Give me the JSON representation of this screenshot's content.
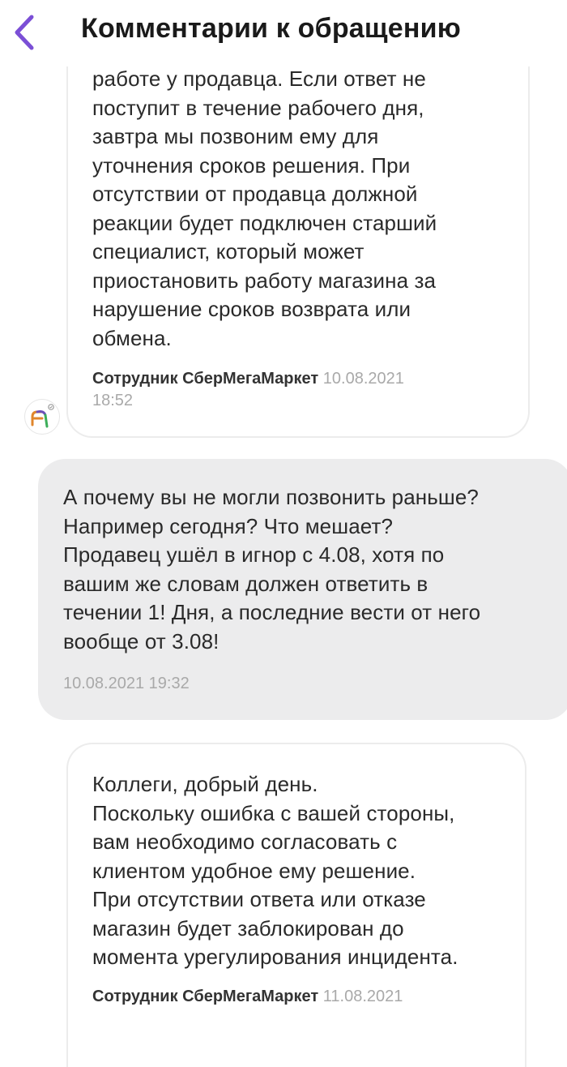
{
  "header": {
    "title": "Комментарии к обращению",
    "back_icon": "chevron-left-icon",
    "accent": "#7b4fd6"
  },
  "messages": [
    {
      "text": "работе у продавца. Если ответ не\nпоступит в течение рабочего дня,\nзавтра мы позвоним ему для\nуточнения сроков решения. При\nотсутствии от продавца должной\nреакции будет подключен старший\nспециалист, который может\nприостановить работу магазина за\nнарушение сроков возврата или\nобмена.",
      "author": "Сотрудник СберМегаМаркет",
      "date": "10.08.2021",
      "time": "18:52"
    },
    {
      "text": "А почему вы не могли позвонить раньше?\nНапример сегодня? Что мешает?\nПродавец ушёл в игнор с 4.08, хотя по\nвашим же словам должен ответить в\nтечении 1! Дня, а последние вести от него\nвообще от 3.08!",
      "timestamp": "10.08.2021 19:32"
    },
    {
      "text": "Коллеги, добрый день.\nПоскольку ошибка с вашей стороны,\nвам необходимо согласовать с\nклиентом удобное ему решение.\nПри отсутствии ответа или отказе\nмагазин будет заблокирован до\nмомента урегулирования инцидента.",
      "author": "Сотрудник СберМегаМаркет",
      "date": "11.08.2021"
    }
  ],
  "colors": {
    "user_bubble": "#ececed",
    "card_border": "#ececec",
    "muted": "#a9a9a9"
  }
}
